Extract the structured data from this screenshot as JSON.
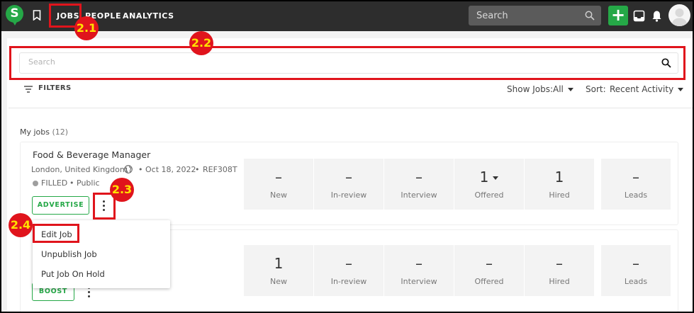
{
  "topbar": {
    "logo_letter": "S",
    "nav": [
      "JOBS",
      "PEOPLE",
      "ANALYTICS"
    ],
    "search_placeholder": "Search",
    "add_symbol": "+"
  },
  "toolbar": {
    "search_placeholder": "Search",
    "filters_label": "FILTERS",
    "show_jobs_label": "Show Jobs:",
    "show_jobs_value": "All",
    "sort_label": "Sort:",
    "sort_value": "Recent Activity"
  },
  "section": {
    "title": "My jobs",
    "count": "(12)"
  },
  "jobs": [
    {
      "title": "Food & Beverage Manager",
      "location": "London, United Kingdom",
      "date": "Oct 18, 2022",
      "ref": "REF308T",
      "status": "FILLED",
      "visibility": "Public",
      "action_label": "ADVERTISE",
      "stats": [
        {
          "label": "New",
          "value": "–"
        },
        {
          "label": "In-review",
          "value": "–"
        },
        {
          "label": "Interview",
          "value": "–"
        },
        {
          "label": "Offered",
          "value": "1"
        },
        {
          "label": "Hired",
          "value": "1"
        },
        {
          "label": "Leads",
          "value": "–"
        }
      ]
    },
    {
      "action_label": "BOOST",
      "stats": [
        {
          "label": "New",
          "value": "1"
        },
        {
          "label": "In-review",
          "value": "–"
        },
        {
          "label": "Interview",
          "value": "–"
        },
        {
          "label": "Offered",
          "value": "–"
        },
        {
          "label": "Hired",
          "value": "–"
        },
        {
          "label": "Leads",
          "value": "–"
        }
      ]
    }
  ],
  "job_menu": [
    "Edit Job",
    "Unpublish Job",
    "Put Job On Hold"
  ],
  "annotations": [
    "2.1",
    "2.2",
    "2.3",
    "2.4"
  ],
  "colors": {
    "brand_green": "#25a847",
    "annotation_red": "#e0141c",
    "annotation_text": "#ffe100",
    "topbar": "#2d2d2d"
  }
}
